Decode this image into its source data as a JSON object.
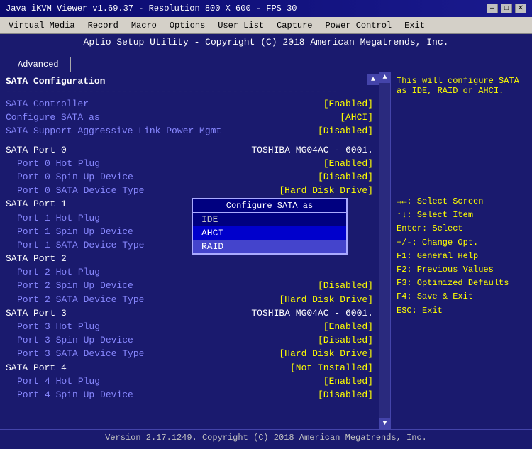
{
  "window": {
    "title": "Java iKVM Viewer v1.69.37 - Resolution 800 X 600 - FPS 30",
    "controls": {
      "minimize": "—",
      "maximize": "□",
      "close": "✕"
    }
  },
  "menu": {
    "items": [
      "Virtual Media",
      "Record",
      "Macro",
      "Options",
      "User List",
      "Capture",
      "Power Control",
      "Exit"
    ]
  },
  "header": {
    "title": "Aptio Setup Utility - Copyright (C) 2018 American Megatrends, Inc."
  },
  "tabs": [
    {
      "label": "Advanced",
      "active": true
    }
  ],
  "bios": {
    "section1_title": "SATA Configuration",
    "divider": "------------------------------------------------------------",
    "rows": [
      {
        "label": "SATA Controller",
        "value": "[Enabled]",
        "sub": false
      },
      {
        "label": "Configure SATA as",
        "value": "[AHCI]",
        "sub": false
      },
      {
        "label": "SATA Support Aggressive Link Power Mgmt",
        "value": "[Disabled]",
        "sub": false
      },
      {
        "label": "",
        "value": "",
        "sub": false
      },
      {
        "label": "SATA Port 0",
        "value": "TOSHIBA MG04AC - 6001.",
        "sub": false,
        "section": true
      },
      {
        "label": "Port 0 Hot Plug",
        "value": "[Enabled]",
        "sub": true
      },
      {
        "label": "Port 0 Spin Up Device",
        "value": "[Disabled]",
        "sub": true
      },
      {
        "label": "Port 0 SATA Device Type",
        "value": "[Hard Disk Drive]",
        "sub": true
      },
      {
        "label": "SATA Port 1",
        "value": "",
        "sub": false,
        "section": true
      },
      {
        "label": "Port 1 Hot Plug",
        "value": "",
        "sub": true
      },
      {
        "label": "Port 1 Spin Up Device",
        "value": "",
        "sub": true
      },
      {
        "label": "Port 1 SATA Device Type",
        "value": "",
        "sub": true
      },
      {
        "label": "SATA Port 2",
        "value": "",
        "sub": false,
        "section": true
      },
      {
        "label": "Port 2 Hot Plug",
        "value": "",
        "sub": true
      },
      {
        "label": "Port 2 Spin Up Device",
        "value": "[Disabled]",
        "sub": true
      },
      {
        "label": "Port 2 SATA Device Type",
        "value": "[Hard Disk Drive]",
        "sub": true
      },
      {
        "label": "SATA Port 3",
        "value": "TOSHIBA MG04AC - 6001.",
        "sub": false,
        "section": true
      },
      {
        "label": "Port 3 Hot Plug",
        "value": "[Enabled]",
        "sub": true
      },
      {
        "label": "Port 3 Spin Up Device",
        "value": "[Disabled]",
        "sub": true
      },
      {
        "label": "Port 3 SATA Device Type",
        "value": "[Hard Disk Drive]",
        "sub": true
      },
      {
        "label": "SATA Port 4",
        "value": "[Not Installed]",
        "sub": false,
        "section": true
      },
      {
        "label": "Port 4 Hot Plug",
        "value": "[Enabled]",
        "sub": true
      },
      {
        "label": "Port 4 Spin Up Device",
        "value": "[Disabled]",
        "sub": true
      }
    ]
  },
  "dropdown": {
    "title": "Configure SATA as",
    "options": [
      "IDE",
      "AHCI",
      "RAID"
    ],
    "selected": "RAID"
  },
  "right_pane": {
    "help_text": "This will configure SATA as IDE, RAID or AHCI.",
    "shortcuts": [
      "→←: Select Screen",
      "↑↓: Select Item",
      "Enter: Select",
      "+/-: Change Opt.",
      "F1: General Help",
      "F2: Previous Values",
      "F3: Optimized Defaults",
      "F4: Save & Exit",
      "ESC: Exit"
    ]
  },
  "footer": {
    "text": "Version 2.17.1249. Copyright (C) 2018 American Megatrends, Inc."
  }
}
